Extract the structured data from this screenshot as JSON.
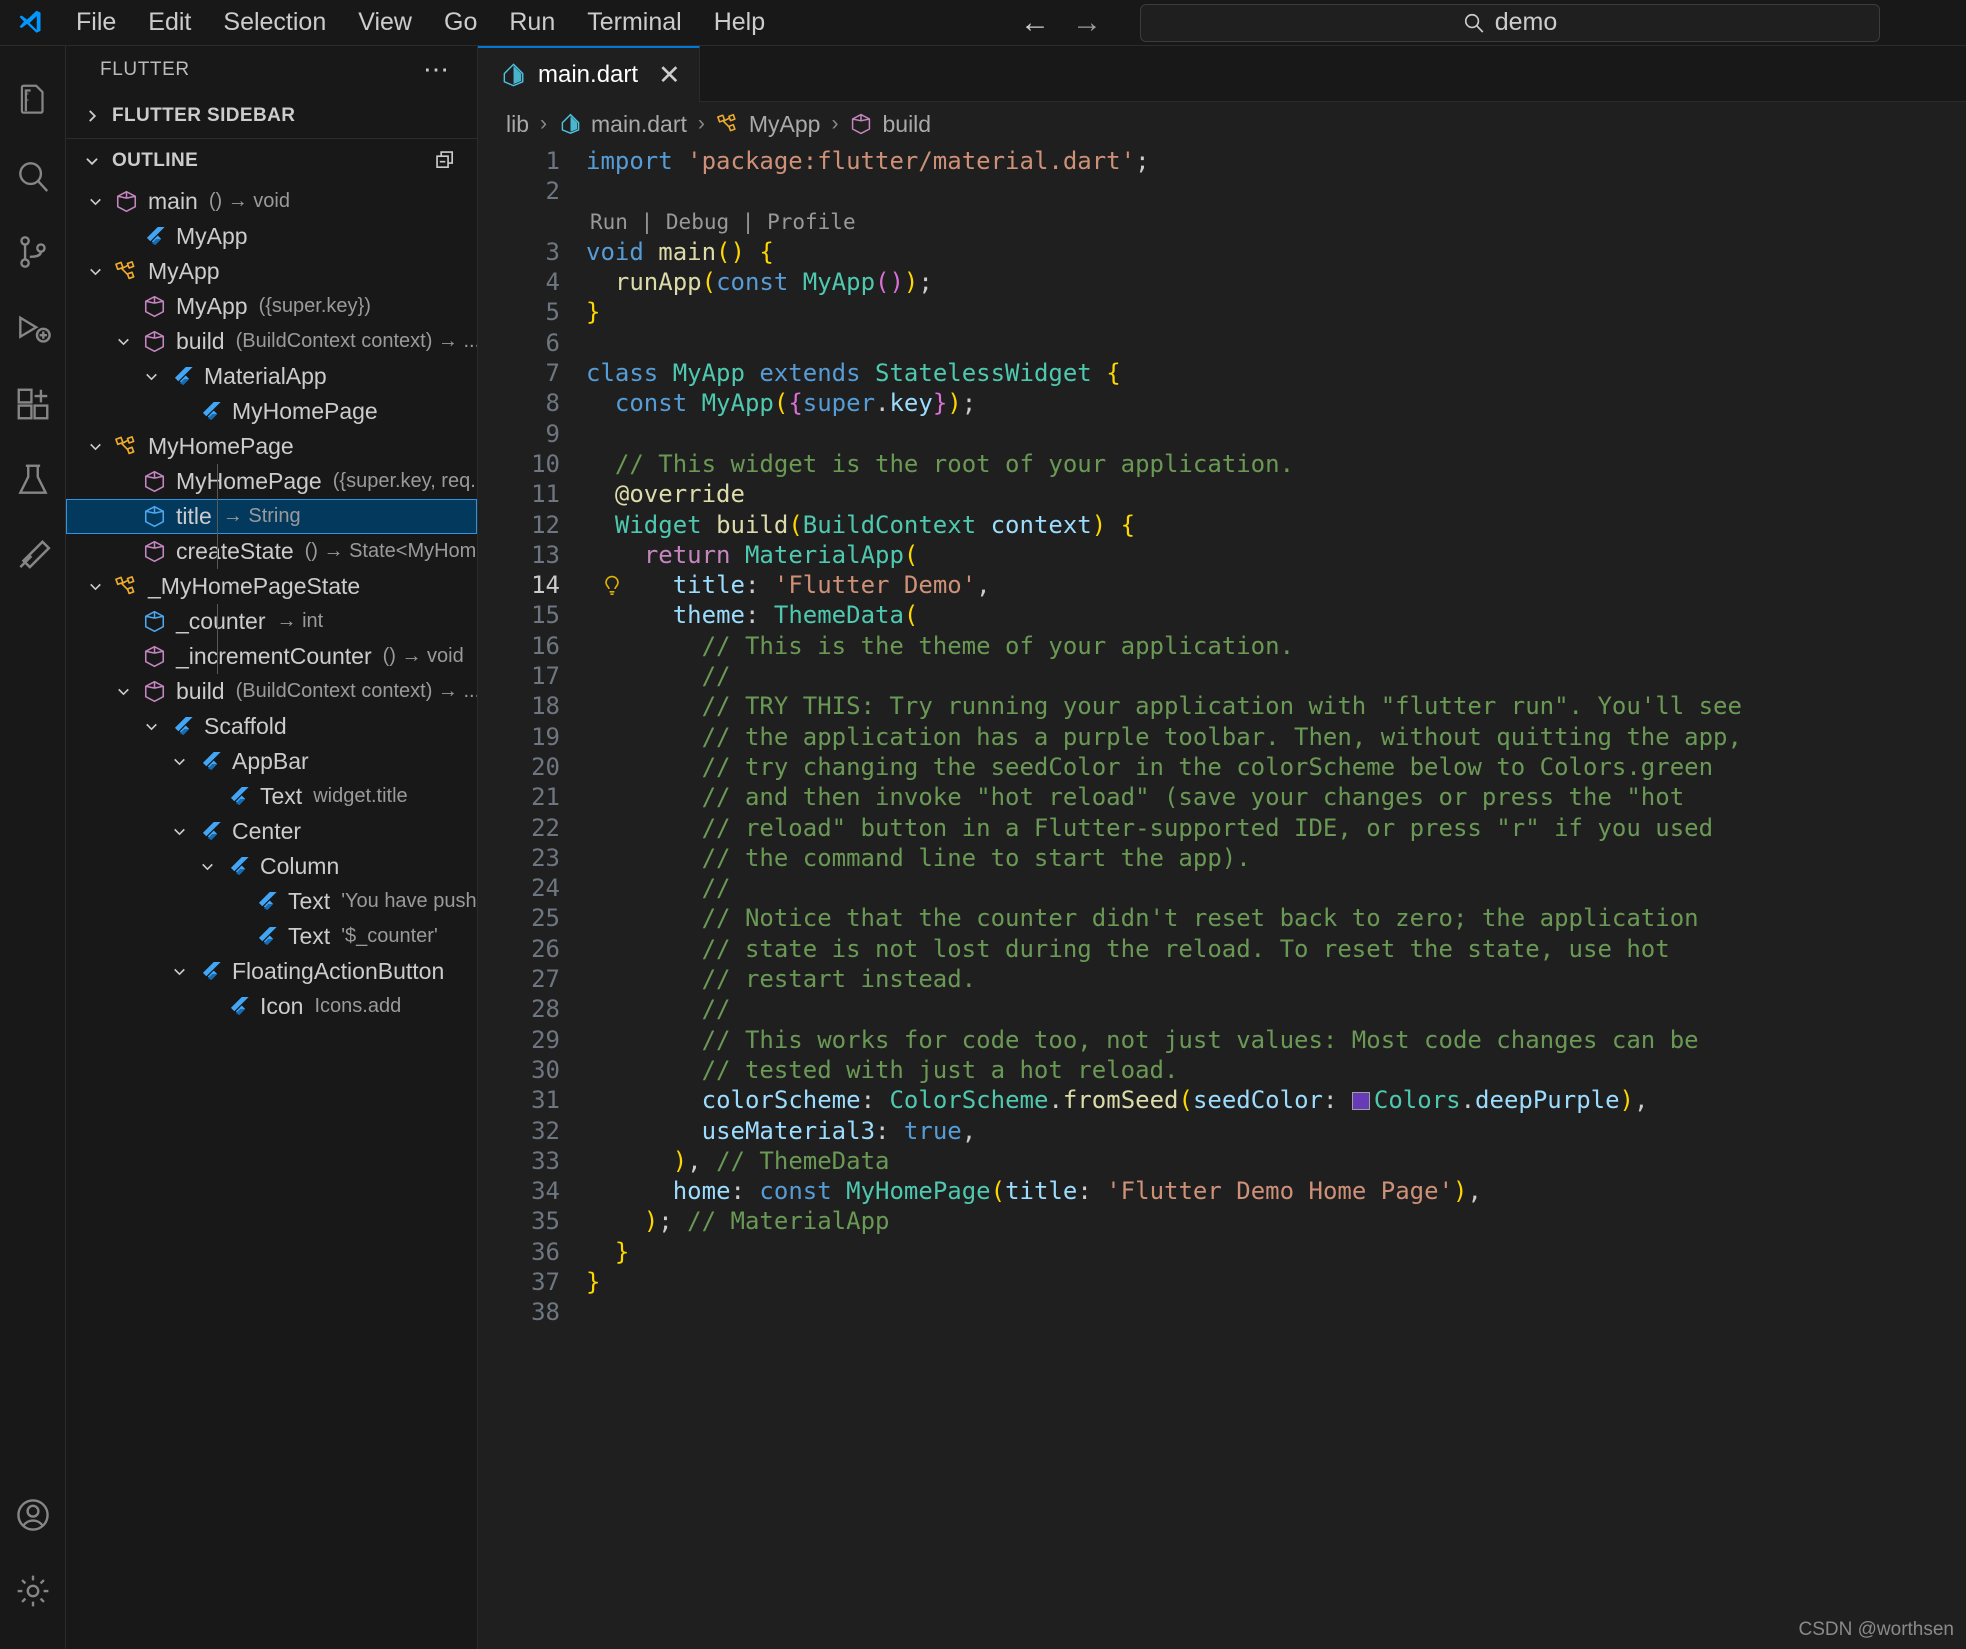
{
  "titlebar": {
    "menus": [
      "File",
      "Edit",
      "Selection",
      "View",
      "Go",
      "Run",
      "Terminal",
      "Help"
    ],
    "nav_back": "←",
    "nav_forward": "→",
    "search_text": "demo",
    "search_icon": "search-icon",
    "logo_icon": "vscode-logo-icon"
  },
  "activitybar": {
    "items": [
      {
        "name": "explorer",
        "icon": "files-icon"
      },
      {
        "name": "search",
        "icon": "search-icon"
      },
      {
        "name": "source-control",
        "icon": "source-control-icon"
      },
      {
        "name": "run-and-debug",
        "icon": "debug-icon"
      },
      {
        "name": "extensions",
        "icon": "extensions-icon"
      },
      {
        "name": "testing",
        "icon": "beaker-icon"
      },
      {
        "name": "flutter",
        "icon": "flutter-icon"
      },
      {
        "name": "accounts",
        "icon": "account-icon"
      },
      {
        "name": "manage",
        "icon": "gear-icon"
      }
    ]
  },
  "sidebar": {
    "title": "FLUTTER",
    "more_actions": "⋯",
    "sections": [
      {
        "label": "FLUTTER SIDEBAR",
        "expanded": false
      },
      {
        "label": "OUTLINE",
        "expanded": true,
        "action_icon": "collapse-all-icon"
      }
    ],
    "outline": [
      {
        "depth": 0,
        "twisty": "down",
        "icon": "method-icon",
        "label": "main",
        "detail": "() → void",
        "selected": false
      },
      {
        "depth": 1,
        "twisty": "none",
        "icon": "flutter-icon",
        "label": "MyApp",
        "detail": "",
        "selected": false
      },
      {
        "depth": 0,
        "twisty": "down",
        "icon": "class-icon",
        "label": "MyApp",
        "detail": "",
        "selected": false
      },
      {
        "depth": 1,
        "twisty": "none",
        "icon": "method-icon",
        "label": "MyApp",
        "detail": "({super.key})",
        "selected": false
      },
      {
        "depth": 1,
        "twisty": "down",
        "icon": "method-icon",
        "label": "build",
        "detail": "(BuildContext context) → ...",
        "selected": false
      },
      {
        "depth": 2,
        "twisty": "down",
        "icon": "flutter-icon",
        "label": "MaterialApp",
        "detail": "",
        "selected": false
      },
      {
        "depth": 3,
        "twisty": "none",
        "icon": "flutter-icon",
        "label": "MyHomePage",
        "detail": "",
        "selected": false
      },
      {
        "depth": 0,
        "twisty": "down",
        "icon": "class-icon",
        "label": "MyHomePage",
        "detail": "",
        "selected": false
      },
      {
        "depth": 1,
        "twisty": "none",
        "icon": "method-icon",
        "label": "MyHomePage",
        "detail": "({super.key, req...",
        "selected": false
      },
      {
        "depth": 1,
        "twisty": "none",
        "icon": "field-icon",
        "label": "title",
        "detail": "→ String",
        "selected": true
      },
      {
        "depth": 1,
        "twisty": "none",
        "icon": "method-icon",
        "label": "createState",
        "detail": "() → State<MyHom...",
        "selected": false
      },
      {
        "depth": 0,
        "twisty": "down",
        "icon": "class-icon",
        "label": "_MyHomePageState",
        "detail": "",
        "selected": false
      },
      {
        "depth": 1,
        "twisty": "none",
        "icon": "field-icon",
        "label": "_counter",
        "detail": "→ int",
        "selected": false
      },
      {
        "depth": 1,
        "twisty": "none",
        "icon": "method-icon",
        "label": "_incrementCounter",
        "detail": "() → void",
        "selected": false
      },
      {
        "depth": 1,
        "twisty": "down",
        "icon": "method-icon",
        "label": "build",
        "detail": "(BuildContext context) → ...",
        "selected": false
      },
      {
        "depth": 2,
        "twisty": "down",
        "icon": "flutter-icon",
        "label": "Scaffold",
        "detail": "",
        "selected": false
      },
      {
        "depth": 3,
        "twisty": "down",
        "icon": "flutter-icon",
        "label": "AppBar",
        "detail": "",
        "selected": false
      },
      {
        "depth": 4,
        "twisty": "none",
        "icon": "flutter-icon",
        "label": "Text",
        "detail": "widget.title",
        "selected": false
      },
      {
        "depth": 3,
        "twisty": "down",
        "icon": "flutter-icon",
        "label": "Center",
        "detail": "",
        "selected": false
      },
      {
        "depth": 4,
        "twisty": "down",
        "icon": "flutter-icon",
        "label": "Column",
        "detail": "",
        "selected": false
      },
      {
        "depth": 5,
        "twisty": "none",
        "icon": "flutter-icon",
        "label": "Text",
        "detail": "'You have pushed th...",
        "selected": false
      },
      {
        "depth": 5,
        "twisty": "none",
        "icon": "flutter-icon",
        "label": "Text",
        "detail": "'$_counter'",
        "selected": false
      },
      {
        "depth": 3,
        "twisty": "down",
        "icon": "flutter-icon",
        "label": "FloatingActionButton",
        "detail": "",
        "selected": false
      },
      {
        "depth": 4,
        "twisty": "none",
        "icon": "flutter-icon",
        "label": "Icon",
        "detail": "Icons.add",
        "selected": false
      }
    ]
  },
  "editor": {
    "tab": {
      "name": "main.dart",
      "icon": "dart-file-icon",
      "close": "✕",
      "active": true
    },
    "breadcrumbs": [
      {
        "label": "lib",
        "icon": null
      },
      {
        "label": "main.dart",
        "icon": "dart-file-icon"
      },
      {
        "label": "MyApp",
        "icon": "class-icon"
      },
      {
        "label": "build",
        "icon": "method-icon"
      }
    ],
    "breadcrumb_separator": "›",
    "codelens": {
      "run": "Run",
      "debug": "Debug",
      "profile": "Profile",
      "separator": "|"
    },
    "first_line": 1,
    "last_line": 38,
    "active_line": 14,
    "lightbulb_line": 14,
    "color_swatch": "#673ab7",
    "lines": [
      {
        "n": 1,
        "t": "import 'package:flutter/material.dart';"
      },
      {
        "n": 2,
        "t": ""
      },
      {
        "n": 3,
        "t": "void main() {"
      },
      {
        "n": 4,
        "t": "  runApp(const MyApp());"
      },
      {
        "n": 5,
        "t": "}"
      },
      {
        "n": 6,
        "t": ""
      },
      {
        "n": 7,
        "t": "class MyApp extends StatelessWidget {"
      },
      {
        "n": 8,
        "t": "  const MyApp({super.key});"
      },
      {
        "n": 9,
        "t": ""
      },
      {
        "n": 10,
        "t": "  // This widget is the root of your application."
      },
      {
        "n": 11,
        "t": "  @override"
      },
      {
        "n": 12,
        "t": "  Widget build(BuildContext context) {"
      },
      {
        "n": 13,
        "t": "    return MaterialApp("
      },
      {
        "n": 14,
        "t": "      title: 'Flutter Demo',"
      },
      {
        "n": 15,
        "t": "      theme: ThemeData("
      },
      {
        "n": 16,
        "t": "        // This is the theme of your application."
      },
      {
        "n": 17,
        "t": "        //"
      },
      {
        "n": 18,
        "t": "        // TRY THIS: Try running your application with \"flutter run\". You'll see"
      },
      {
        "n": 19,
        "t": "        // the application has a purple toolbar. Then, without quitting the app,"
      },
      {
        "n": 20,
        "t": "        // try changing the seedColor in the colorScheme below to Colors.green"
      },
      {
        "n": 21,
        "t": "        // and then invoke \"hot reload\" (save your changes or press the \"hot"
      },
      {
        "n": 22,
        "t": "        // reload\" button in a Flutter-supported IDE, or press \"r\" if you used"
      },
      {
        "n": 23,
        "t": "        // the command line to start the app)."
      },
      {
        "n": 24,
        "t": "        //"
      },
      {
        "n": 25,
        "t": "        // Notice that the counter didn't reset back to zero; the application"
      },
      {
        "n": 26,
        "t": "        // state is not lost during the reload. To reset the state, use hot"
      },
      {
        "n": 27,
        "t": "        // restart instead."
      },
      {
        "n": 28,
        "t": "        //"
      },
      {
        "n": 29,
        "t": "        // This works for code too, not just values: Most code changes can be"
      },
      {
        "n": 30,
        "t": "        // tested with just a hot reload."
      },
      {
        "n": 31,
        "t": "        colorScheme: ColorScheme.fromSeed(seedColor: Colors.deepPurple),"
      },
      {
        "n": 32,
        "t": "        useMaterial3: true,"
      },
      {
        "n": 33,
        "t": "      ), // ThemeData"
      },
      {
        "n": 34,
        "t": "      home: const MyHomePage(title: 'Flutter Demo Home Page'),"
      },
      {
        "n": 35,
        "t": "    ); // MaterialApp"
      },
      {
        "n": 36,
        "t": "  }"
      },
      {
        "n": 37,
        "t": "}"
      },
      {
        "n": 38,
        "t": ""
      }
    ]
  },
  "watermark": "CSDN @worthsen",
  "colors": {
    "accent": "#0078d4",
    "selection": "#04395e",
    "selection_border": "#2f93e0",
    "editor_bg": "#1f1f1f",
    "chrome_bg": "#181818",
    "keyword": "#569cd6",
    "type": "#4ec9b0",
    "comment": "#6a9955",
    "string": "#ce9178",
    "function": "#dcdcaa",
    "variable": "#9cdcfe",
    "control": "#c586c0"
  }
}
